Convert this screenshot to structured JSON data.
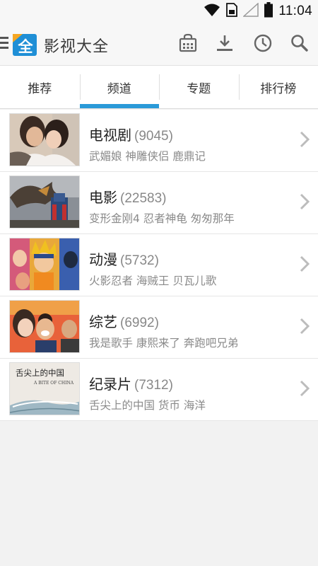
{
  "status_bar": {
    "time": "11:04",
    "icons": [
      "wifi-icon",
      "sim-icon",
      "signal-icon",
      "battery-icon"
    ]
  },
  "app_bar": {
    "logo_text": "全",
    "title": "影视大全",
    "actions": [
      "store-icon",
      "download-icon",
      "history-icon",
      "search-icon"
    ]
  },
  "tabs": [
    {
      "label": "推荐",
      "active": false
    },
    {
      "label": "频道",
      "active": true
    },
    {
      "label": "专题",
      "active": false
    },
    {
      "label": "排行榜",
      "active": false
    }
  ],
  "channels": [
    {
      "title": "电视剧",
      "count": "(9045)",
      "subtitle": "武媚娘 神雕侠侣 鹿鼎记"
    },
    {
      "title": "电影",
      "count": "(22583)",
      "subtitle": "变形金刚4 忍者神龟 匆匆那年"
    },
    {
      "title": "动漫",
      "count": "(5732)",
      "subtitle": "火影忍者 海贼王 贝瓦儿歌"
    },
    {
      "title": "综艺",
      "count": "(6992)",
      "subtitle": "我是歌手 康熙来了 奔跑吧兄弟"
    },
    {
      "title": "纪录片",
      "count": "(7312)",
      "subtitle": "舌尖上的中国 货币 海洋"
    }
  ],
  "thumb_text": {
    "documentary": "舌尖上的中国",
    "documentary_en": "A BITE OF CHINA"
  },
  "colors": {
    "accent": "#2a9ad8",
    "logo_blue": "#1f8fd6",
    "logo_badge": "#f5a623"
  }
}
